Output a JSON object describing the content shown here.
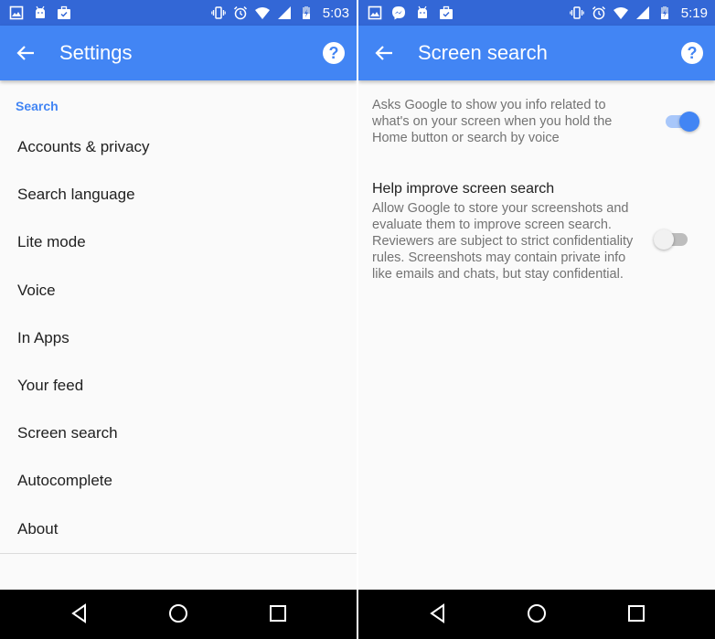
{
  "left_screen": {
    "status_bar": {
      "notification_icons": [
        "gallery-icon",
        "android-icon",
        "briefcase-check-icon"
      ],
      "system_icons": [
        "vibrate-icon",
        "alarm-icon",
        "wifi-icon",
        "cell-signal-icon",
        "battery-charging-icon"
      ],
      "time": "5:03"
    },
    "app_bar": {
      "title": "Settings",
      "back_icon": "arrow-back-icon",
      "help_icon": "help-circle-icon",
      "help_glyph": "?"
    },
    "section_header": "Search",
    "menu_items": [
      {
        "label": "Accounts & privacy"
      },
      {
        "label": "Search language"
      },
      {
        "label": "Lite mode"
      },
      {
        "label": "Voice"
      },
      {
        "label": "In Apps"
      },
      {
        "label": "Your feed"
      },
      {
        "label": "Screen search"
      },
      {
        "label": "Autocomplete"
      },
      {
        "label": "About"
      }
    ]
  },
  "right_screen": {
    "status_bar": {
      "notification_icons": [
        "gallery-icon",
        "messenger-icon",
        "android-icon",
        "briefcase-check-icon"
      ],
      "system_icons": [
        "vibrate-icon",
        "alarm-icon",
        "wifi-icon",
        "cell-signal-icon",
        "battery-charging-icon"
      ],
      "time": "5:19"
    },
    "app_bar": {
      "title": "Screen search",
      "back_icon": "arrow-back-icon",
      "help_icon": "help-circle-icon",
      "help_glyph": "?"
    },
    "settings": [
      {
        "title": "",
        "description": "Asks Google to show you info related to what's on your screen when you hold the Home button or search by voice",
        "enabled": true
      },
      {
        "title": "Help improve screen search",
        "description": "Allow Google to store your screenshots and evaluate them to improve screen search. Reviewers are subject to strict confidentiality rules. Screenshots may contain private info like emails and chats, but stay confidential.",
        "enabled": false
      }
    ]
  },
  "nav_bar": {
    "buttons": [
      "back-triangle-icon",
      "home-circle-icon",
      "recents-square-icon"
    ]
  },
  "colors": {
    "status_bar": "#3367d6",
    "app_bar": "#4285f4",
    "accent": "#4285f4",
    "background": "#fafafa",
    "nav_bar": "#000000"
  }
}
